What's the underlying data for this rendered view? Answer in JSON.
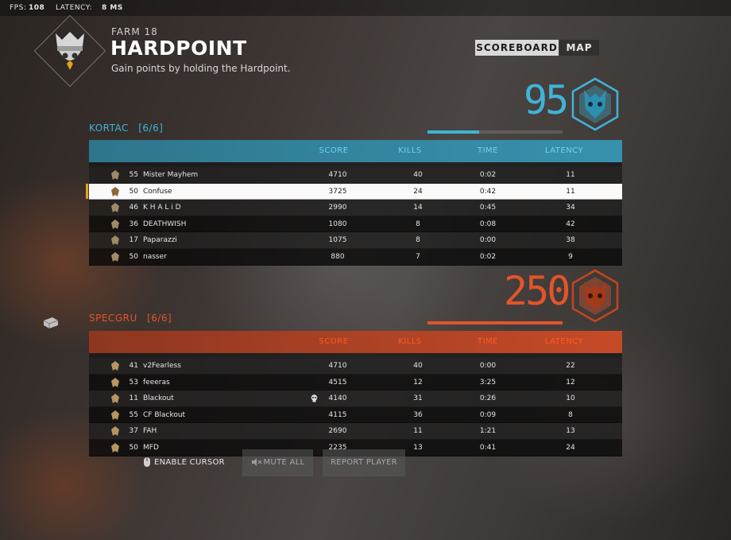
{
  "hud": {
    "fps_label": "FPS:",
    "fps_value": "108",
    "latency_label": "LATENCY:",
    "latency_value": "8 MS"
  },
  "match": {
    "map": "FARM 18",
    "mode": "HARDPOINT",
    "description": "Gain points by holding the Hardpoint."
  },
  "tabs": {
    "scoreboard": "SCOREBOARD",
    "map": "MAP"
  },
  "colors": {
    "kortac": "#3fb4d8",
    "specgru": "#e2542b",
    "highlight": "#e6a21e"
  },
  "columns": {
    "score": "SCORE",
    "kills": "KILLS",
    "time": "TIME",
    "latency": "LATENCY"
  },
  "teams": {
    "kortac": {
      "name": "KORTAC",
      "count": "[6/6]",
      "score": "95",
      "progress": 0.38,
      "players": [
        {
          "level": "55",
          "name": "Mister Mayhem",
          "score": "4710",
          "kills": "40",
          "time": "0:02",
          "latency": "11"
        },
        {
          "level": "50",
          "name": "Confuse",
          "score": "3725",
          "kills": "24",
          "time": "0:42",
          "latency": "11"
        },
        {
          "level": "46",
          "name": "K H A L i D",
          "score": "2990",
          "kills": "14",
          "time": "0:45",
          "latency": "34"
        },
        {
          "level": "36",
          "name": "DEATHWISH",
          "score": "1080",
          "kills": "8",
          "time": "0:08",
          "latency": "42"
        },
        {
          "level": "17",
          "name": "Paparazzi",
          "score": "1075",
          "kills": "8",
          "time": "0:00",
          "latency": "38"
        },
        {
          "level": "50",
          "name": "nasser",
          "score": "880",
          "kills": "7",
          "time": "0:02",
          "latency": "9"
        }
      ]
    },
    "specgru": {
      "name": "SPECGRU",
      "count": "[6/6]",
      "score": "250",
      "progress": 1.0,
      "players": [
        {
          "level": "41",
          "name": "v2Fearless",
          "score": "4710",
          "kills": "40",
          "time": "0:00",
          "latency": "22"
        },
        {
          "level": "53",
          "name": "feeeras",
          "score": "4515",
          "kills": "12",
          "time": "3:25",
          "latency": "12"
        },
        {
          "level": "11",
          "name": "Blackout",
          "score": "4140",
          "kills": "31",
          "time": "0:26",
          "latency": "10"
        },
        {
          "level": "55",
          "name": "CF Blackout",
          "score": "4115",
          "kills": "36",
          "time": "0:09",
          "latency": "8"
        },
        {
          "level": "37",
          "name": "FAH",
          "score": "2690",
          "kills": "11",
          "time": "1:21",
          "latency": "13"
        },
        {
          "level": "50",
          "name": "MFD",
          "score": "2235",
          "kills": "13",
          "time": "0:41",
          "latency": "24"
        }
      ]
    }
  },
  "actions": {
    "enable_cursor": "ENABLE CURSOR",
    "mute_all": "MUTE ALL",
    "report_player": "REPORT PLAYER"
  }
}
